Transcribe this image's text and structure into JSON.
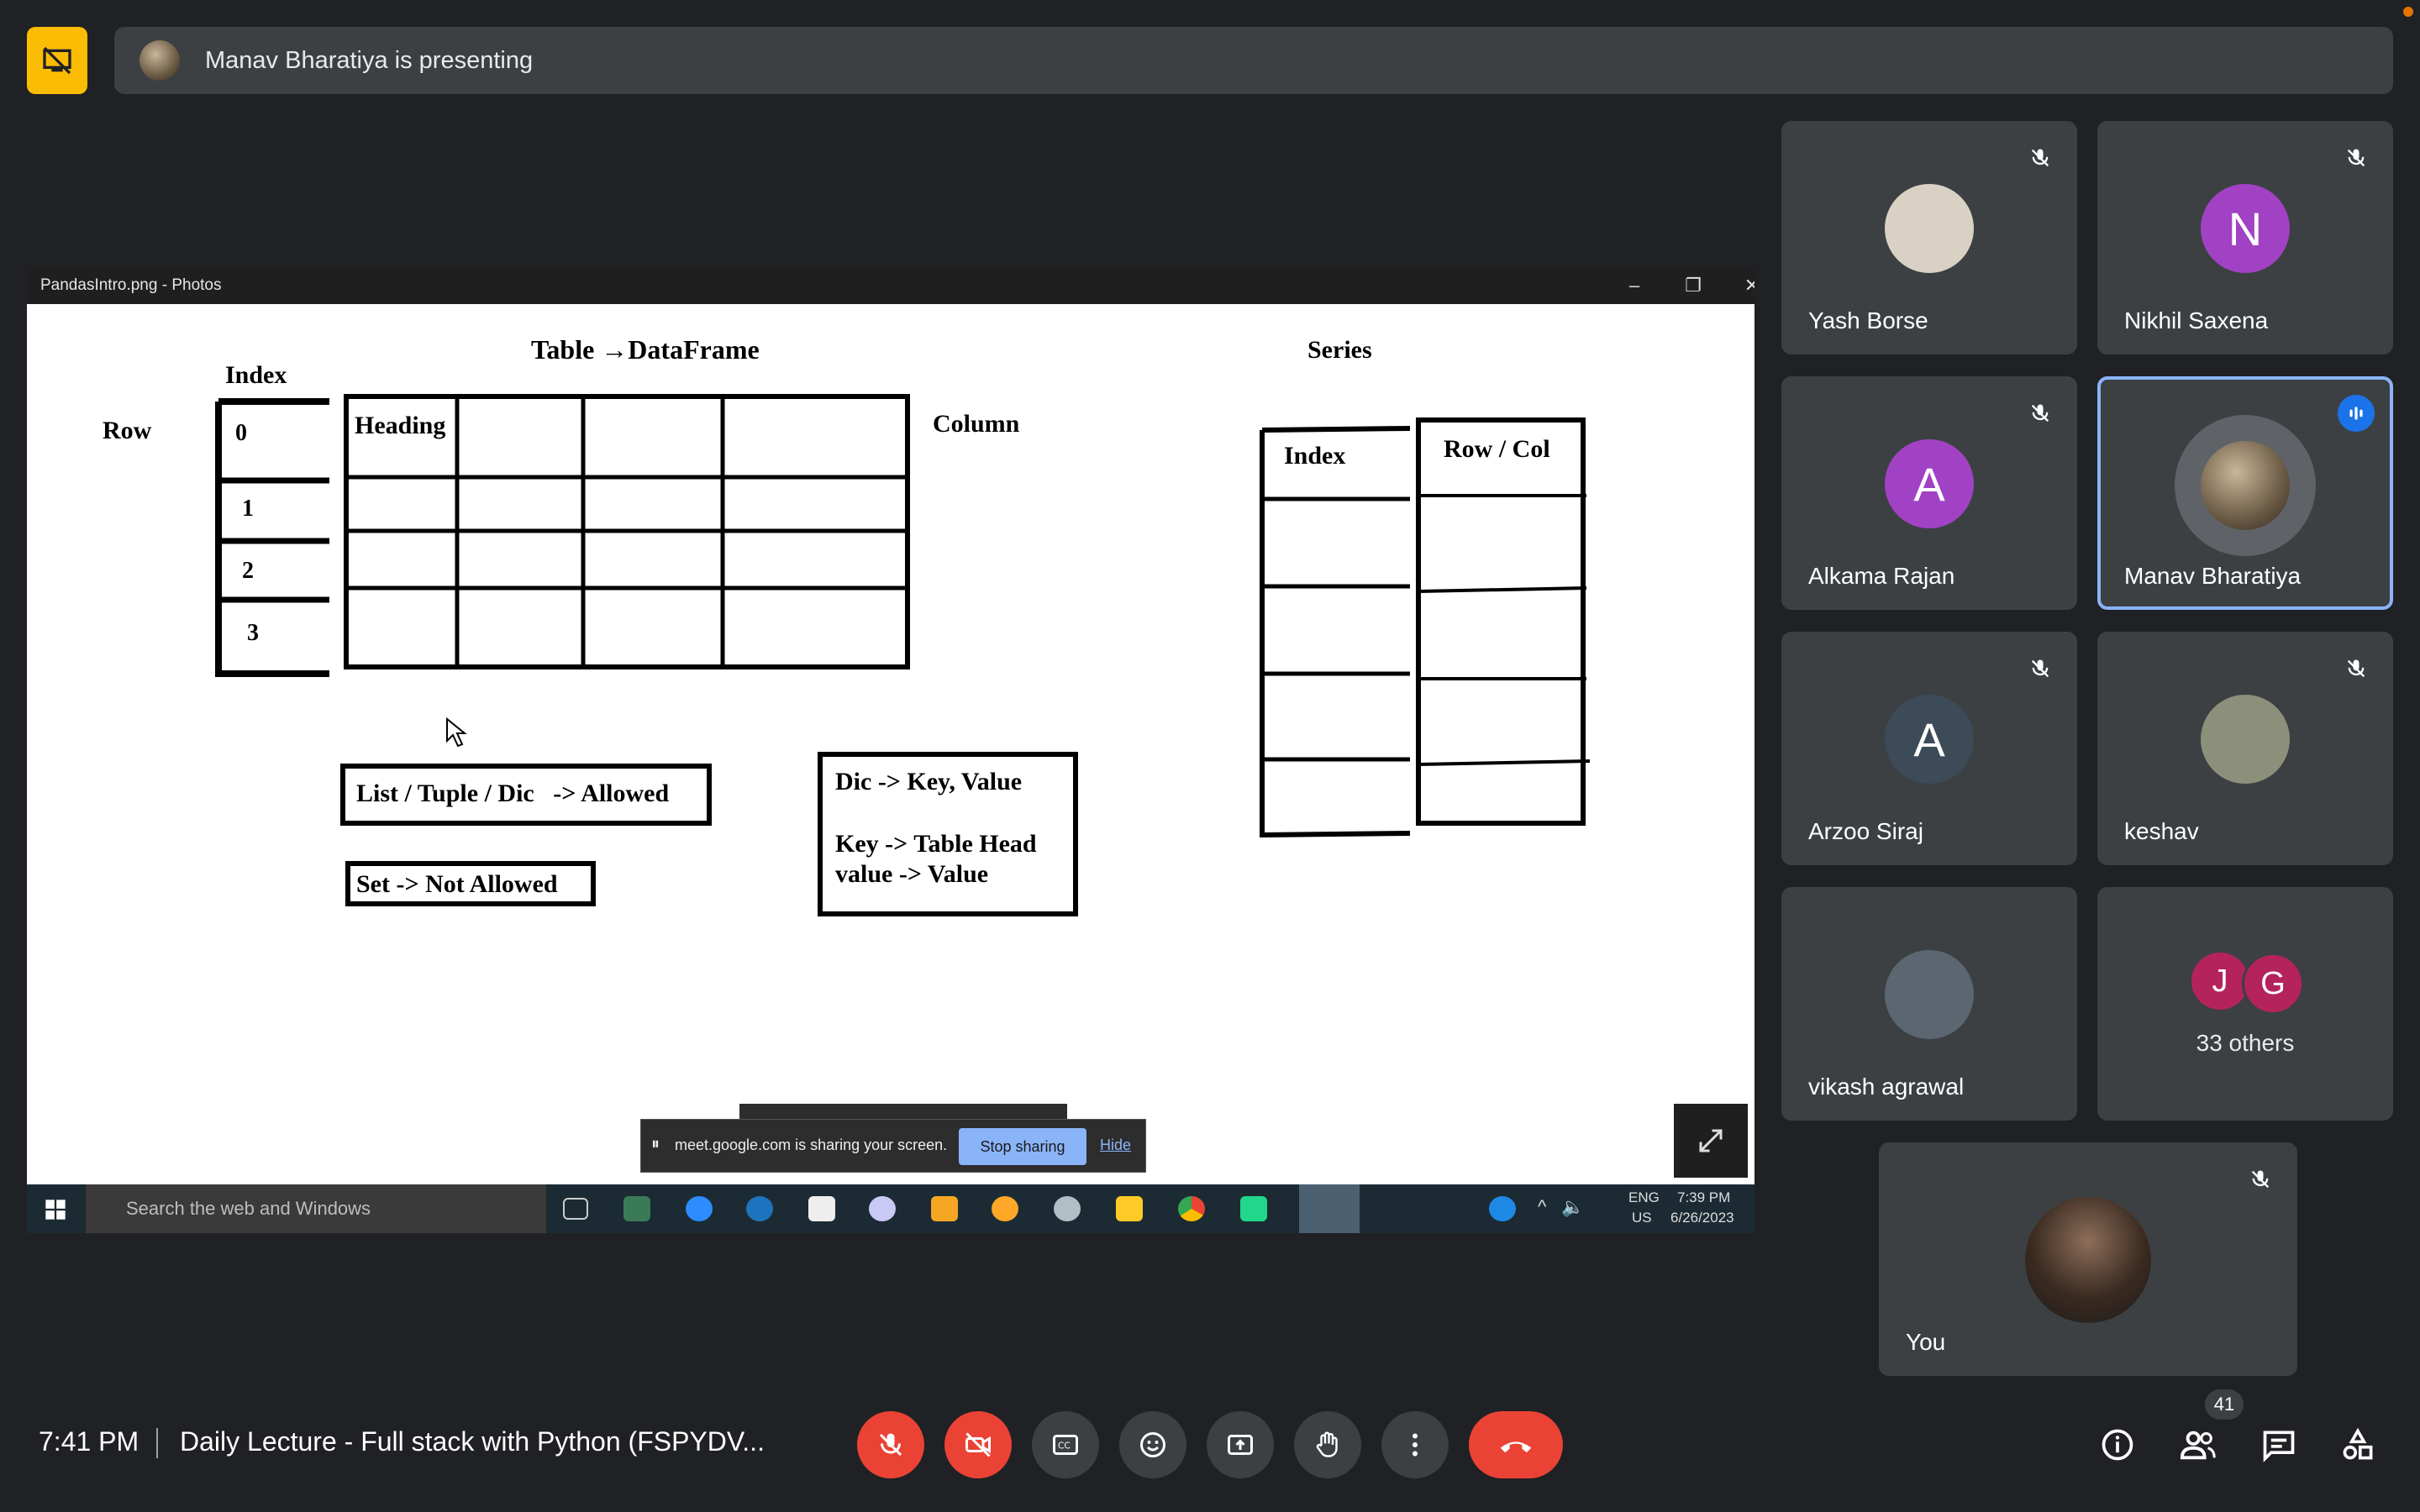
{
  "presentation": {
    "presenter_text": "Manav Bharatiya is presenting"
  },
  "shared_window": {
    "title": "PandasIntro.png - Photos",
    "diagram": {
      "dataframe_title": "Table →DataFrame",
      "index_label": "Index",
      "row_label": "Row",
      "column_label": "Column",
      "heading_label": "Heading",
      "row_indices": [
        "0",
        "1",
        "2",
        "3"
      ],
      "allowed_text": "List / Tuple / Dic   -> Allowed",
      "not_allowed_text": "Set -> Not Allowed",
      "dic_line1": "Dic -> Key, Value",
      "dic_line2": "Key -> Table Head",
      "dic_line3": "value -> Value",
      "series_title": "Series",
      "series_index": "Index",
      "series_rowcol": "Row / Col"
    },
    "share_banner": {
      "message": "meet.google.com is sharing your screen.",
      "stop_label": "Stop sharing",
      "hide_label": "Hide"
    },
    "taskbar": {
      "search_placeholder": "Search the web and Windows",
      "lang": "ENG",
      "region": "US",
      "time": "7:39 PM",
      "date": "6/26/2023"
    }
  },
  "participants": [
    {
      "name": "Yash Borse",
      "initial": "",
      "avatar_color": "#d9d2c4"
    },
    {
      "name": "Nikhil Saxena",
      "initial": "N",
      "avatar_color": "#a142c4"
    },
    {
      "name": "Alkama Rajan",
      "initial": "A",
      "avatar_color": "#a142c4"
    },
    {
      "name": "Manav Bharatiya",
      "initial": "",
      "avatar_color": "#8a7a5e"
    },
    {
      "name": "Arzoo Siraj",
      "initial": "A",
      "avatar_color": "#3c4b57"
    },
    {
      "name": "keshav",
      "initial": "",
      "avatar_color": "#8c8f7a"
    },
    {
      "name": "vikash agrawal",
      "initial": "",
      "avatar_color": "#5b6670"
    }
  ],
  "others": {
    "initial1": "J",
    "initial2": "G",
    "label": "33 others"
  },
  "self_tile": {
    "name": "You"
  },
  "meeting": {
    "time": "7:41 PM",
    "title": "Daily Lecture - Full stack with Python (FSPYDV..."
  },
  "people_count": "41",
  "colors": {
    "background": "#202124",
    "tile": "#3c4043",
    "danger": "#ea4335",
    "accent": "#8ab4f8",
    "presenting": "#fbbc04"
  }
}
